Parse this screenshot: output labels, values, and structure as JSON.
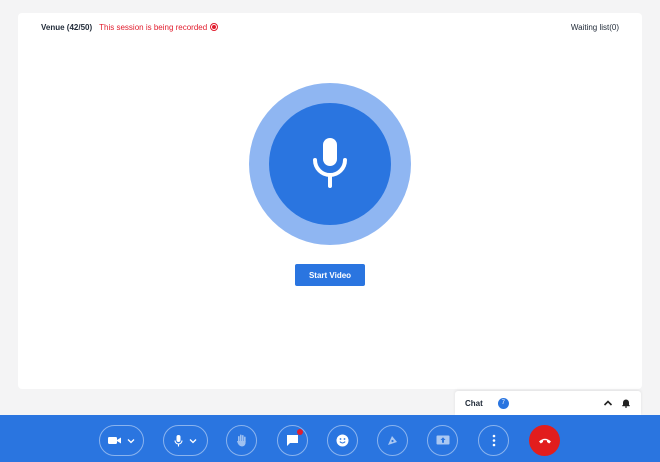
{
  "header": {
    "venue": "Venue (42/50)",
    "recording_notice": "This session is being recorded",
    "waiting_list": "Waiting list(0)"
  },
  "main": {
    "start_video_label": "Start Video",
    "mic_icon": "microphone-icon"
  },
  "chat": {
    "label": "Chat",
    "badge_count": "7"
  },
  "toolbar": {
    "buttons": [
      "camera",
      "microphone",
      "raise-hand",
      "chat",
      "reactions",
      "polls",
      "share-screen",
      "more",
      "end-call"
    ]
  },
  "colors": {
    "accent": "#2a75e0",
    "accent_light": "#8fb6f2",
    "recording": "#e11d2e",
    "end_call": "#e21d1d"
  }
}
